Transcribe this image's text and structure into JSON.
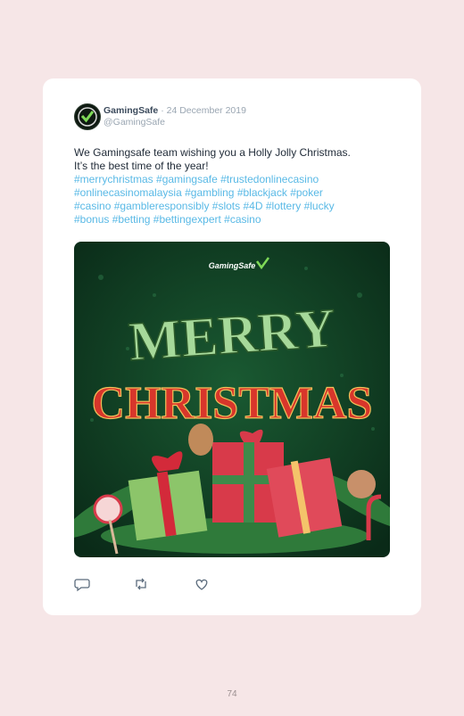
{
  "post": {
    "author_name": "GamingSafe",
    "separator": "·",
    "date": "24 December 2019",
    "handle": "@GamingSafe",
    "text_line1": "We Gamingsafe team wishing you a Holly Jolly Christmas.",
    "text_line2": "It’s the best time of the year!",
    "hashtags": [
      "#merrychristmas",
      "#gamingsafe",
      "#trustedonlinecasino",
      "#onlinecasinomalaysia",
      "#gambling",
      "#blackjack",
      "#poker",
      "#casino",
      "#gambleresponsibly",
      "#slots",
      "#4D",
      "#lottery",
      "#lucky",
      "#bonus",
      "#betting",
      "#bettingexpert",
      "#casino"
    ],
    "image": {
      "logo_text": "GamingSafe",
      "line1": "MERRY",
      "line2": "CHRISTMAS"
    }
  },
  "actions": {
    "reply_icon": "comment-icon",
    "retweet_icon": "retweet-icon",
    "like_icon": "heart-icon"
  },
  "page_number": "74",
  "colors": {
    "background": "#f6e6e7",
    "card": "#ffffff",
    "hashtag": "#59b9e6",
    "image_bg": "#0f3a22",
    "merry": "#a6d99a",
    "christmas": "#d8362b"
  }
}
